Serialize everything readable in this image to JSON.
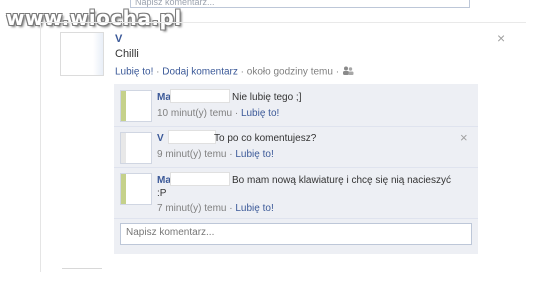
{
  "watermark": "www.wiocha.pl",
  "top_input": {
    "placeholder": "Napisz komentarz..."
  },
  "post": {
    "author": "V",
    "text": "Chilli",
    "like_link": "Lubię to!",
    "comment_link": "Dodaj komentarz",
    "time": "około godziny temu",
    "close_icon": "×"
  },
  "comments": [
    {
      "author": "Ma",
      "text": "Nie lubię tego ;]",
      "time": "10 minut(y) temu",
      "like_link": "Lubię to!"
    },
    {
      "author": "V",
      "text": "To po co komentujesz?",
      "time": "9 minut(y) temu",
      "like_link": "Lubię to!",
      "close_icon": "×"
    },
    {
      "author": "Ma",
      "text": "Bo mam nową klawiaturę i chcę się nią nacieszyć",
      "text2": ":P",
      "time": "7 minut(y) temu",
      "like_link": "Lubię to!"
    }
  ],
  "comment_box": {
    "placeholder": "Napisz komentarz..."
  },
  "separator": "·",
  "colors": {
    "link": "#3b5998",
    "comments_bg": "#edeff4",
    "meta": "#808080"
  },
  "icons": {
    "friends": "friends-icon"
  }
}
